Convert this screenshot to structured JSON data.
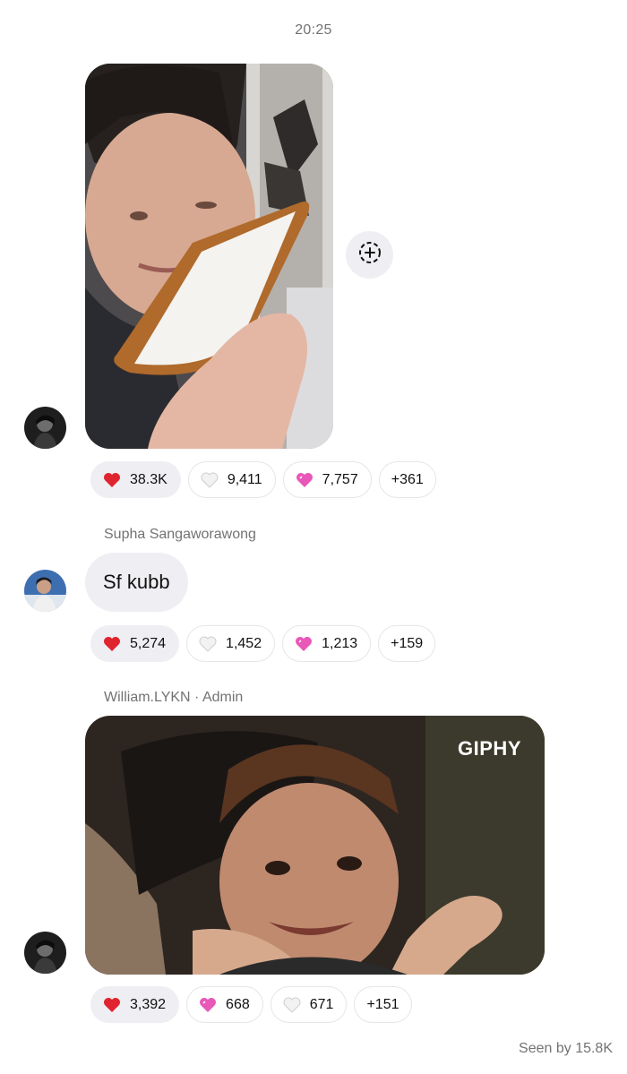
{
  "header": {
    "timestamp": "20:25"
  },
  "messages": [
    {
      "sender": "",
      "type": "photo",
      "reactions": [
        {
          "emoji": "red-heart",
          "count": "38.3K",
          "active": true
        },
        {
          "emoji": "white-heart",
          "count": "9,411",
          "active": false
        },
        {
          "emoji": "pink-heart",
          "count": "7,757",
          "active": false
        },
        {
          "emoji": "",
          "count": "+361",
          "active": false
        }
      ]
    },
    {
      "sender": "Supha Sangaworawong",
      "type": "text",
      "text": "Sf kubb",
      "reactions": [
        {
          "emoji": "red-heart",
          "count": "5,274",
          "active": true
        },
        {
          "emoji": "white-heart",
          "count": "1,452",
          "active": false
        },
        {
          "emoji": "pink-heart",
          "count": "1,213",
          "active": false
        },
        {
          "emoji": "",
          "count": "+159",
          "active": false
        }
      ]
    },
    {
      "sender": "William.LYKN · Admin",
      "type": "gif",
      "gif_label": "GIPHY",
      "reactions": [
        {
          "emoji": "red-heart",
          "count": "3,392",
          "active": true
        },
        {
          "emoji": "pink-heart",
          "count": "668",
          "active": false
        },
        {
          "emoji": "white-heart",
          "count": "671",
          "active": false
        },
        {
          "emoji": "",
          "count": "+151",
          "active": false
        }
      ]
    }
  ],
  "footer": {
    "seen": "Seen by 15.8K"
  },
  "colors": {
    "bubble": "#efeff3",
    "secondary_text": "#737373",
    "red_heart": "#e0242f",
    "pink_heart": "#e858b8"
  },
  "icons": {
    "share": "share-to-story-icon"
  }
}
